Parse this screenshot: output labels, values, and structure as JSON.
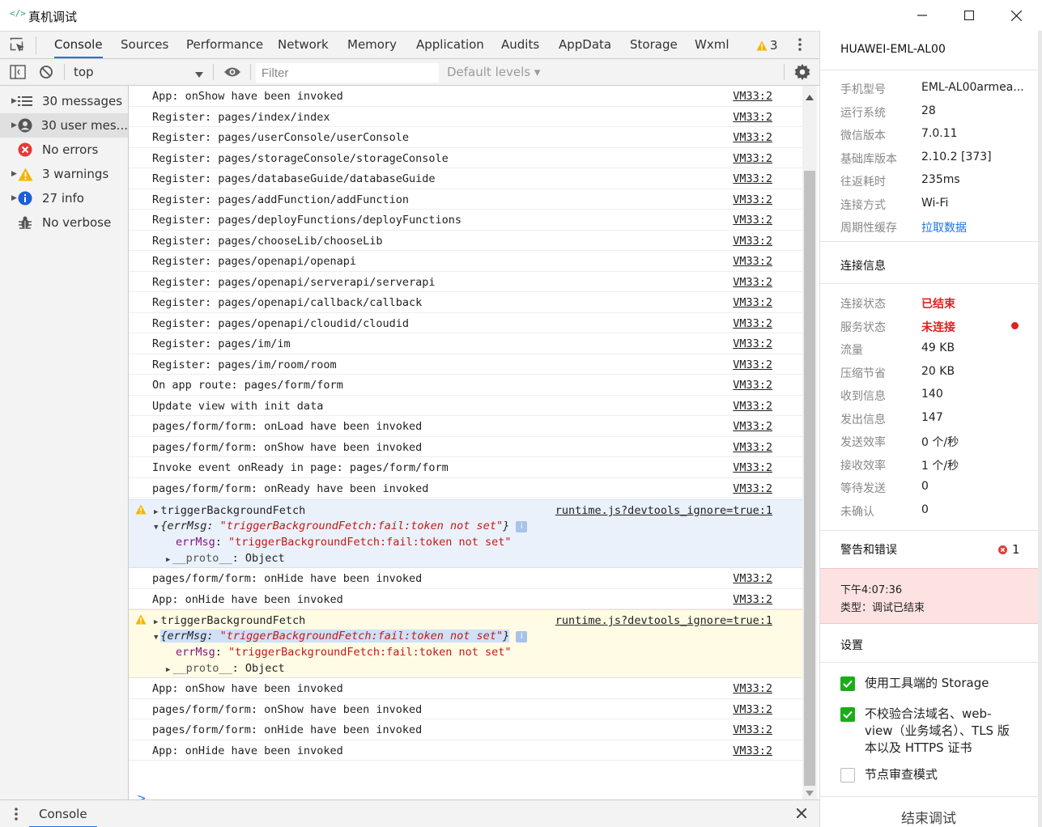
{
  "window": {
    "title": "真机调试"
  },
  "tabs": [
    "Console",
    "Sources",
    "Performance",
    "Network",
    "Memory",
    "Application",
    "Audits",
    "AppData",
    "Storage",
    "Wxml"
  ],
  "active_tab": "Console",
  "warning_badge_count": "3",
  "toolbar": {
    "context": "top",
    "filter_placeholder": "Filter",
    "levels": "Default levels ▾"
  },
  "sidebar": {
    "items": [
      {
        "label": "30 messages",
        "icon": "list-icon"
      },
      {
        "label": "30 user mes...",
        "icon": "user-icon"
      },
      {
        "label": "No errors",
        "icon": "error-icon"
      },
      {
        "label": "3 warnings",
        "icon": "warning-icon"
      },
      {
        "label": "27 info",
        "icon": "info-icon"
      },
      {
        "label": "No verbose",
        "icon": "bug-icon"
      }
    ]
  },
  "logs_top": [
    {
      "msg": "App: onShow have been invoked",
      "src": "VM33:2"
    },
    {
      "msg": "Register: pages/index/index",
      "src": "VM33:2"
    },
    {
      "msg": "Register: pages/userConsole/userConsole",
      "src": "VM33:2"
    },
    {
      "msg": "Register: pages/storageConsole/storageConsole",
      "src": "VM33:2"
    },
    {
      "msg": "Register: pages/databaseGuide/databaseGuide",
      "src": "VM33:2"
    },
    {
      "msg": "Register: pages/addFunction/addFunction",
      "src": "VM33:2"
    },
    {
      "msg": "Register: pages/deployFunctions/deployFunctions",
      "src": "VM33:2"
    },
    {
      "msg": "Register: pages/chooseLib/chooseLib",
      "src": "VM33:2"
    },
    {
      "msg": "Register: pages/openapi/openapi",
      "src": "VM33:2"
    },
    {
      "msg": "Register: pages/openapi/serverapi/serverapi",
      "src": "VM33:2"
    },
    {
      "msg": "Register: pages/openapi/callback/callback",
      "src": "VM33:2"
    },
    {
      "msg": "Register: pages/openapi/cloudid/cloudid",
      "src": "VM33:2"
    },
    {
      "msg": "Register: pages/im/im",
      "src": "VM33:2"
    },
    {
      "msg": "Register: pages/im/room/room",
      "src": "VM33:2"
    },
    {
      "msg": "On app route: pages/form/form",
      "src": "VM33:2"
    },
    {
      "msg": "Update view with init data",
      "src": "VM33:2"
    },
    {
      "msg": "pages/form/form: onLoad have been invoked",
      "src": "VM33:2"
    },
    {
      "msg": "pages/form/form: onShow have been invoked",
      "src": "VM33:2"
    },
    {
      "msg": "Invoke event onReady in page: pages/form/form",
      "src": "VM33:2"
    },
    {
      "msg": "pages/form/form: onReady have been invoked",
      "src": "VM33:2"
    }
  ],
  "warning": {
    "title": "triggerBackgroundFetch",
    "src": "runtime.js?devtools_ignore=true:1",
    "obj_open": "{errMsg: ",
    "obj_value": "\"triggerBackgroundFetch:fail:token not set\"",
    "obj_close": "}",
    "key": "errMsg",
    "value": "\"triggerBackgroundFetch:fail:token not set\"",
    "proto_key": "__proto__",
    "proto_val": ": Object",
    "info_badge": "i"
  },
  "logs_mid": [
    {
      "msg": "pages/form/form: onHide have been invoked",
      "src": "VM33:2"
    },
    {
      "msg": "App: onHide have been invoked",
      "src": "VM33:2"
    }
  ],
  "logs_bottom": [
    {
      "msg": "App: onShow have been invoked",
      "src": "VM33:2"
    },
    {
      "msg": "pages/form/form: onShow have been invoked",
      "src": "VM33:2"
    },
    {
      "msg": "pages/form/form: onHide have been invoked",
      "src": "VM33:2"
    },
    {
      "msg": "App: onHide have been invoked",
      "src": "VM33:2"
    }
  ],
  "prompt": ">",
  "drawer": {
    "tab": "Console"
  },
  "device": {
    "name": "HUAWEI-EML-AL00",
    "info": [
      {
        "k": "手机型号",
        "v": "EML-AL00armea..."
      },
      {
        "k": "运行系统",
        "v": "28"
      },
      {
        "k": "微信版本",
        "v": "7.0.11"
      },
      {
        "k": "基础库版本",
        "v": "2.10.2 [373]"
      },
      {
        "k": "往返耗时",
        "v": "235ms"
      },
      {
        "k": "连接方式",
        "v": "Wi-Fi"
      },
      {
        "k": "周期性缓存",
        "v": "拉取数据"
      }
    ]
  },
  "connection": {
    "title": "连接信息",
    "info": [
      {
        "k": "连接状态",
        "v": "已结束"
      },
      {
        "k": "服务状态",
        "v": "未连接"
      },
      {
        "k": "流量",
        "v": "49 KB"
      },
      {
        "k": "压缩节省",
        "v": "20 KB"
      },
      {
        "k": "收到信息",
        "v": "140"
      },
      {
        "k": "发出信息",
        "v": "147"
      },
      {
        "k": "发送效率",
        "v": "0 个/秒"
      },
      {
        "k": "接收效率",
        "v": "1 个/秒"
      },
      {
        "k": "等待发送",
        "v": "0"
      },
      {
        "k": "未确认",
        "v": "0"
      }
    ]
  },
  "alerts": {
    "title": "警告和错误",
    "count": "1",
    "time": "下午4:07:36",
    "type": "类型：调试已结束"
  },
  "settings": {
    "title": "设置",
    "items": [
      {
        "label": "使用工具端的 Storage",
        "checked": true
      },
      {
        "label": "不校验合法域名、web-view（业务域名）、TLS 版本以及 HTTPS 证书",
        "checked": true
      },
      {
        "label": "节点审查模式",
        "checked": false
      }
    ]
  },
  "end_button": "结束调试",
  "colors": {
    "accent": "#1a73e8",
    "error": "#e02020",
    "check": "#1aad19",
    "warning": "#f2b600"
  }
}
